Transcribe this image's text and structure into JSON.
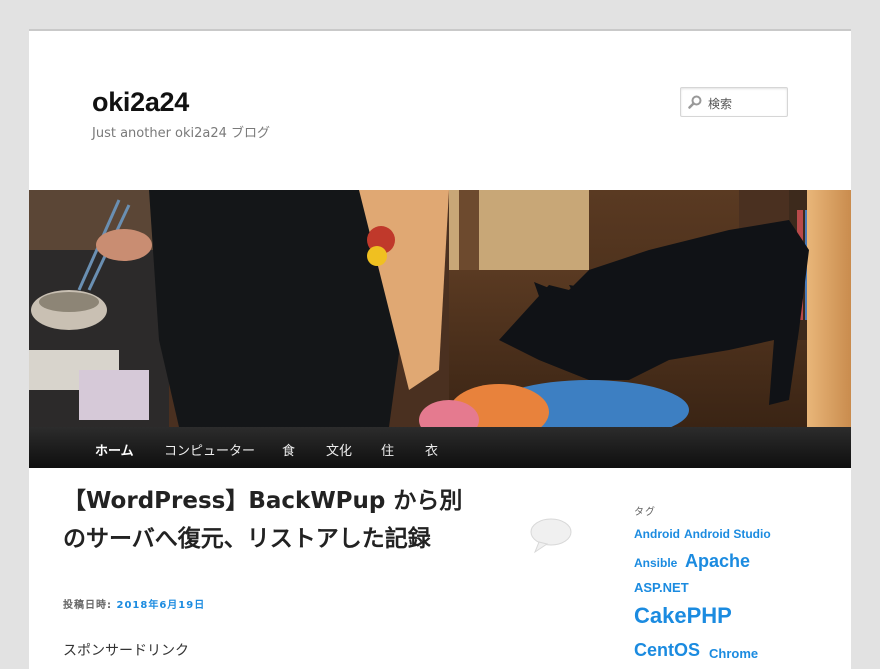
{
  "header": {
    "site_title": "oki2a24",
    "site_description": "Just another oki2a24 ブログ",
    "search_placeholder": "検索"
  },
  "nav": {
    "items": [
      {
        "label": "ホーム",
        "active": true
      },
      {
        "label": "コンピューター",
        "active": false
      },
      {
        "label": "食",
        "active": false
      },
      {
        "label": "文化",
        "active": false
      },
      {
        "label": "住",
        "active": false
      },
      {
        "label": "衣",
        "active": false
      }
    ]
  },
  "post": {
    "title_line1": "【WordPress】BackWPup から別",
    "title_line2": "のサーバへ復元、リストアした記録",
    "meta_label": "投稿日時: ",
    "date": "2018年6月19日",
    "sponsored": "スポンサードリンク"
  },
  "sidebar": {
    "heading": "タグ",
    "tags": [
      "Android",
      "Android Studio",
      "Ansible",
      "Apache",
      "ASP.NET",
      "CakePHP",
      "CentOS",
      "Chrome"
    ]
  },
  "colors": {
    "link": "#1b8be0",
    "nav_bg": "#1a1a1a",
    "page_bg": "#e2e2e2"
  }
}
